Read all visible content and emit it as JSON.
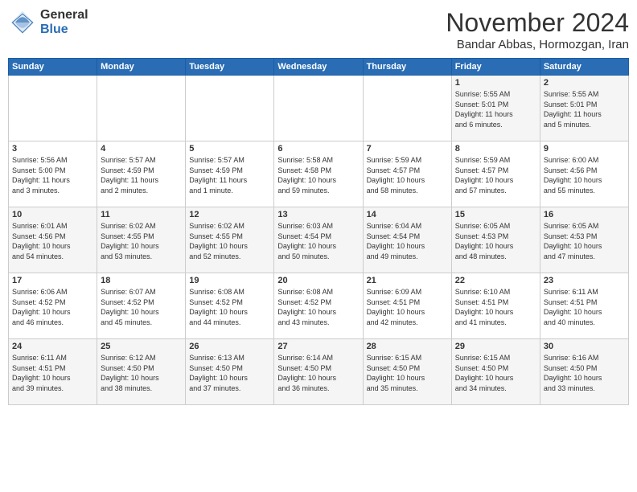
{
  "logo": {
    "general": "General",
    "blue": "Blue"
  },
  "title": "November 2024",
  "subtitle": "Bandar Abbas, Hormozgan, Iran",
  "weekdays": [
    "Sunday",
    "Monday",
    "Tuesday",
    "Wednesday",
    "Thursday",
    "Friday",
    "Saturday"
  ],
  "weeks": [
    [
      {
        "day": "",
        "info": ""
      },
      {
        "day": "",
        "info": ""
      },
      {
        "day": "",
        "info": ""
      },
      {
        "day": "",
        "info": ""
      },
      {
        "day": "",
        "info": ""
      },
      {
        "day": "1",
        "info": "Sunrise: 5:55 AM\nSunset: 5:01 PM\nDaylight: 11 hours\nand 6 minutes."
      },
      {
        "day": "2",
        "info": "Sunrise: 5:55 AM\nSunset: 5:01 PM\nDaylight: 11 hours\nand 5 minutes."
      }
    ],
    [
      {
        "day": "3",
        "info": "Sunrise: 5:56 AM\nSunset: 5:00 PM\nDaylight: 11 hours\nand 3 minutes."
      },
      {
        "day": "4",
        "info": "Sunrise: 5:57 AM\nSunset: 4:59 PM\nDaylight: 11 hours\nand 2 minutes."
      },
      {
        "day": "5",
        "info": "Sunrise: 5:57 AM\nSunset: 4:59 PM\nDaylight: 11 hours\nand 1 minute."
      },
      {
        "day": "6",
        "info": "Sunrise: 5:58 AM\nSunset: 4:58 PM\nDaylight: 10 hours\nand 59 minutes."
      },
      {
        "day": "7",
        "info": "Sunrise: 5:59 AM\nSunset: 4:57 PM\nDaylight: 10 hours\nand 58 minutes."
      },
      {
        "day": "8",
        "info": "Sunrise: 5:59 AM\nSunset: 4:57 PM\nDaylight: 10 hours\nand 57 minutes."
      },
      {
        "day": "9",
        "info": "Sunrise: 6:00 AM\nSunset: 4:56 PM\nDaylight: 10 hours\nand 55 minutes."
      }
    ],
    [
      {
        "day": "10",
        "info": "Sunrise: 6:01 AM\nSunset: 4:56 PM\nDaylight: 10 hours\nand 54 minutes."
      },
      {
        "day": "11",
        "info": "Sunrise: 6:02 AM\nSunset: 4:55 PM\nDaylight: 10 hours\nand 53 minutes."
      },
      {
        "day": "12",
        "info": "Sunrise: 6:02 AM\nSunset: 4:55 PM\nDaylight: 10 hours\nand 52 minutes."
      },
      {
        "day": "13",
        "info": "Sunrise: 6:03 AM\nSunset: 4:54 PM\nDaylight: 10 hours\nand 50 minutes."
      },
      {
        "day": "14",
        "info": "Sunrise: 6:04 AM\nSunset: 4:54 PM\nDaylight: 10 hours\nand 49 minutes."
      },
      {
        "day": "15",
        "info": "Sunrise: 6:05 AM\nSunset: 4:53 PM\nDaylight: 10 hours\nand 48 minutes."
      },
      {
        "day": "16",
        "info": "Sunrise: 6:05 AM\nSunset: 4:53 PM\nDaylight: 10 hours\nand 47 minutes."
      }
    ],
    [
      {
        "day": "17",
        "info": "Sunrise: 6:06 AM\nSunset: 4:52 PM\nDaylight: 10 hours\nand 46 minutes."
      },
      {
        "day": "18",
        "info": "Sunrise: 6:07 AM\nSunset: 4:52 PM\nDaylight: 10 hours\nand 45 minutes."
      },
      {
        "day": "19",
        "info": "Sunrise: 6:08 AM\nSunset: 4:52 PM\nDaylight: 10 hours\nand 44 minutes."
      },
      {
        "day": "20",
        "info": "Sunrise: 6:08 AM\nSunset: 4:52 PM\nDaylight: 10 hours\nand 43 minutes."
      },
      {
        "day": "21",
        "info": "Sunrise: 6:09 AM\nSunset: 4:51 PM\nDaylight: 10 hours\nand 42 minutes."
      },
      {
        "day": "22",
        "info": "Sunrise: 6:10 AM\nSunset: 4:51 PM\nDaylight: 10 hours\nand 41 minutes."
      },
      {
        "day": "23",
        "info": "Sunrise: 6:11 AM\nSunset: 4:51 PM\nDaylight: 10 hours\nand 40 minutes."
      }
    ],
    [
      {
        "day": "24",
        "info": "Sunrise: 6:11 AM\nSunset: 4:51 PM\nDaylight: 10 hours\nand 39 minutes."
      },
      {
        "day": "25",
        "info": "Sunrise: 6:12 AM\nSunset: 4:50 PM\nDaylight: 10 hours\nand 38 minutes."
      },
      {
        "day": "26",
        "info": "Sunrise: 6:13 AM\nSunset: 4:50 PM\nDaylight: 10 hours\nand 37 minutes."
      },
      {
        "day": "27",
        "info": "Sunrise: 6:14 AM\nSunset: 4:50 PM\nDaylight: 10 hours\nand 36 minutes."
      },
      {
        "day": "28",
        "info": "Sunrise: 6:15 AM\nSunset: 4:50 PM\nDaylight: 10 hours\nand 35 minutes."
      },
      {
        "day": "29",
        "info": "Sunrise: 6:15 AM\nSunset: 4:50 PM\nDaylight: 10 hours\nand 34 minutes."
      },
      {
        "day": "30",
        "info": "Sunrise: 6:16 AM\nSunset: 4:50 PM\nDaylight: 10 hours\nand 33 minutes."
      }
    ]
  ]
}
